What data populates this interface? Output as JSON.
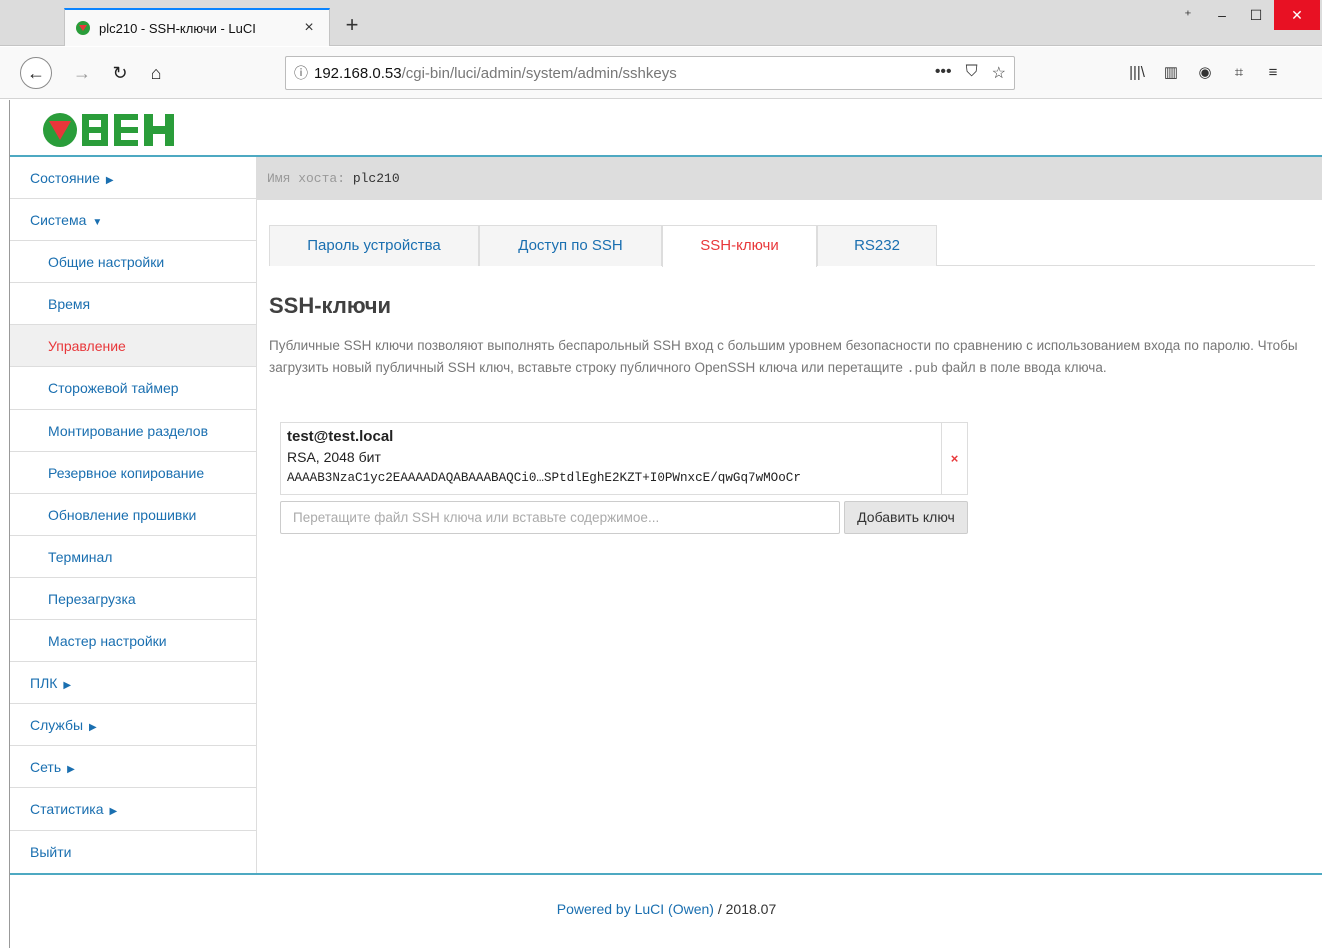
{
  "browser": {
    "tab_title": "plc210 - SSH-ключи - LuCI",
    "tab_close": "×",
    "new_tab": "+",
    "url_host": "192.168.0.53",
    "url_path": "/cgi-bin/luci/admin/system/admin/sshkeys",
    "icons": {
      "favicon": "oven-favicon-icon",
      "back": "back-arrow-icon",
      "forward": "forward-arrow-icon",
      "reload": "reload-icon",
      "home": "home-icon",
      "info": "info-icon",
      "page_actions": "more-icon",
      "pocket": "pocket-icon",
      "bookmark": "star-icon",
      "library": "library-icon",
      "sidebar": "sidebar-icon",
      "account": "account-icon",
      "screenshot": "crop-icon",
      "menu": "hamburger-menu-icon"
    }
  },
  "header": {
    "logo_text": "ОВЕН",
    "logo_color": "#2a9d3a"
  },
  "sidebar": {
    "items": [
      {
        "label": "Состояние",
        "caret": "▶",
        "level": 0
      },
      {
        "label": "Система",
        "caret": "▼",
        "level": 0
      },
      {
        "label": "Общие настройки",
        "level": 1
      },
      {
        "label": "Время",
        "level": 1
      },
      {
        "label": "Управление",
        "level": 1,
        "active": true
      },
      {
        "label": "Сторожевой таймер",
        "level": 1
      },
      {
        "label": "Монтирование разделов",
        "level": 1
      },
      {
        "label": "Резервное копирование",
        "level": 1
      },
      {
        "label": "Обновление прошивки",
        "level": 1
      },
      {
        "label": "Терминал",
        "level": 1
      },
      {
        "label": "Перезагрузка",
        "level": 1
      },
      {
        "label": "Мастер настройки",
        "level": 1
      },
      {
        "label": "ПЛК",
        "caret": "▶",
        "level": 0
      },
      {
        "label": "Службы",
        "caret": "▶",
        "level": 0
      },
      {
        "label": "Сеть",
        "caret": "▶",
        "level": 0
      },
      {
        "label": "Статистика",
        "caret": "▶",
        "level": 0
      },
      {
        "label": "Выйти",
        "level": 0
      }
    ]
  },
  "main": {
    "hostname_label": "Имя хоста:",
    "hostname_value": "plc210",
    "tabs": [
      {
        "label": "Пароль устройства"
      },
      {
        "label": "Доступ по SSH"
      },
      {
        "label": "SSH-ключи",
        "active": true
      },
      {
        "label": "RS232"
      }
    ],
    "section_title": "SSH-ключи",
    "description_before": "Публичные SSH ключи позволяют выполнять беспарольный SSH вход с большим уровнем безопасности по сравнению с использованием входа по паролю. Чтобы загрузить новый публичный SSH ключ, вставьте строку публичного OpenSSH ключа или перетащите ",
    "description_code": ".pub",
    "description_after": " файл в поле ввода ключа.",
    "key": {
      "title": "test@test.local",
      "type": "RSA, 2048 бит",
      "data": "AAAAB3NzaC1yc2EAAAADAQABAAABAQCi0…SPtdlEghE2KZT+I0PWnxcE/qwGq7wMOoCr",
      "remove_label": "×"
    },
    "add_placeholder": "Перетащите файл SSH ключа или вставьте содержимое...",
    "add_button": "Добавить ключ"
  },
  "footer": {
    "powered_link": "Powered by LuCI (Owen)",
    "version": " / 2018.07"
  },
  "colors": {
    "link": "#1a6fb0",
    "active": "#e8373a",
    "accent_line": "#4ea9c2"
  }
}
